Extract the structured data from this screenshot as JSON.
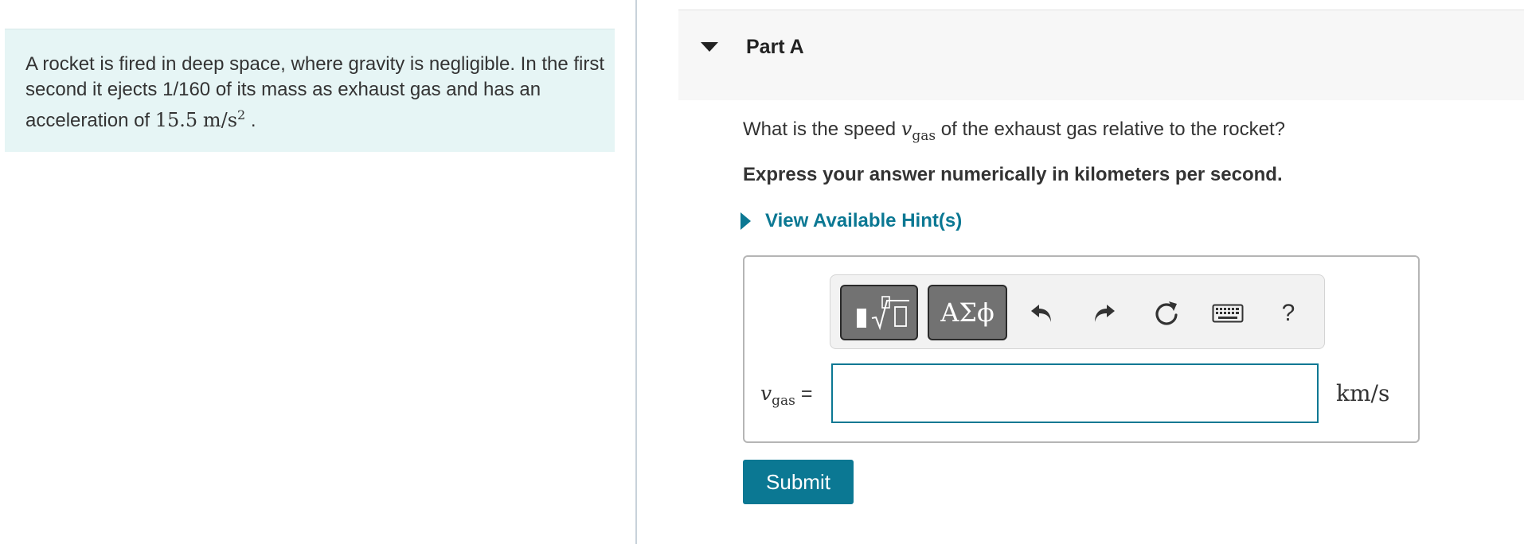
{
  "problem": {
    "text_main": "A rocket is fired in deep space, where gravity is negligible. In the first second it ejects 1/160 of its mass as exhaust gas and has an acceleration of ",
    "accel_value": "15.5",
    "accel_unit": "m/s",
    "accel_exp": "2",
    "text_end": " ."
  },
  "part": {
    "title": "Part A"
  },
  "question": {
    "before": "What is the speed ",
    "var": "v",
    "var_sub": "gas",
    "after": " of the exhaust gas relative to the rocket?"
  },
  "instruction": "Express your answer numerically in kilometers per second.",
  "hint": {
    "label": "View Available Hint(s)"
  },
  "toolbar": {
    "templates_icon": "templates-icon",
    "greek_label": "ΑΣϕ",
    "undo_icon": "undo-icon",
    "redo_icon": "redo-icon",
    "reset_icon": "reset-icon",
    "keyboard_icon": "keyboard-icon",
    "help_label": "?"
  },
  "answer": {
    "var": "v",
    "var_sub": "gas",
    "equals": " =",
    "value": "",
    "unit": "km/s"
  },
  "submit_label": "Submit",
  "colors": {
    "accent": "#0b7893",
    "problem_bg": "#e6f5f5",
    "header_bg": "#f7f7f7"
  }
}
